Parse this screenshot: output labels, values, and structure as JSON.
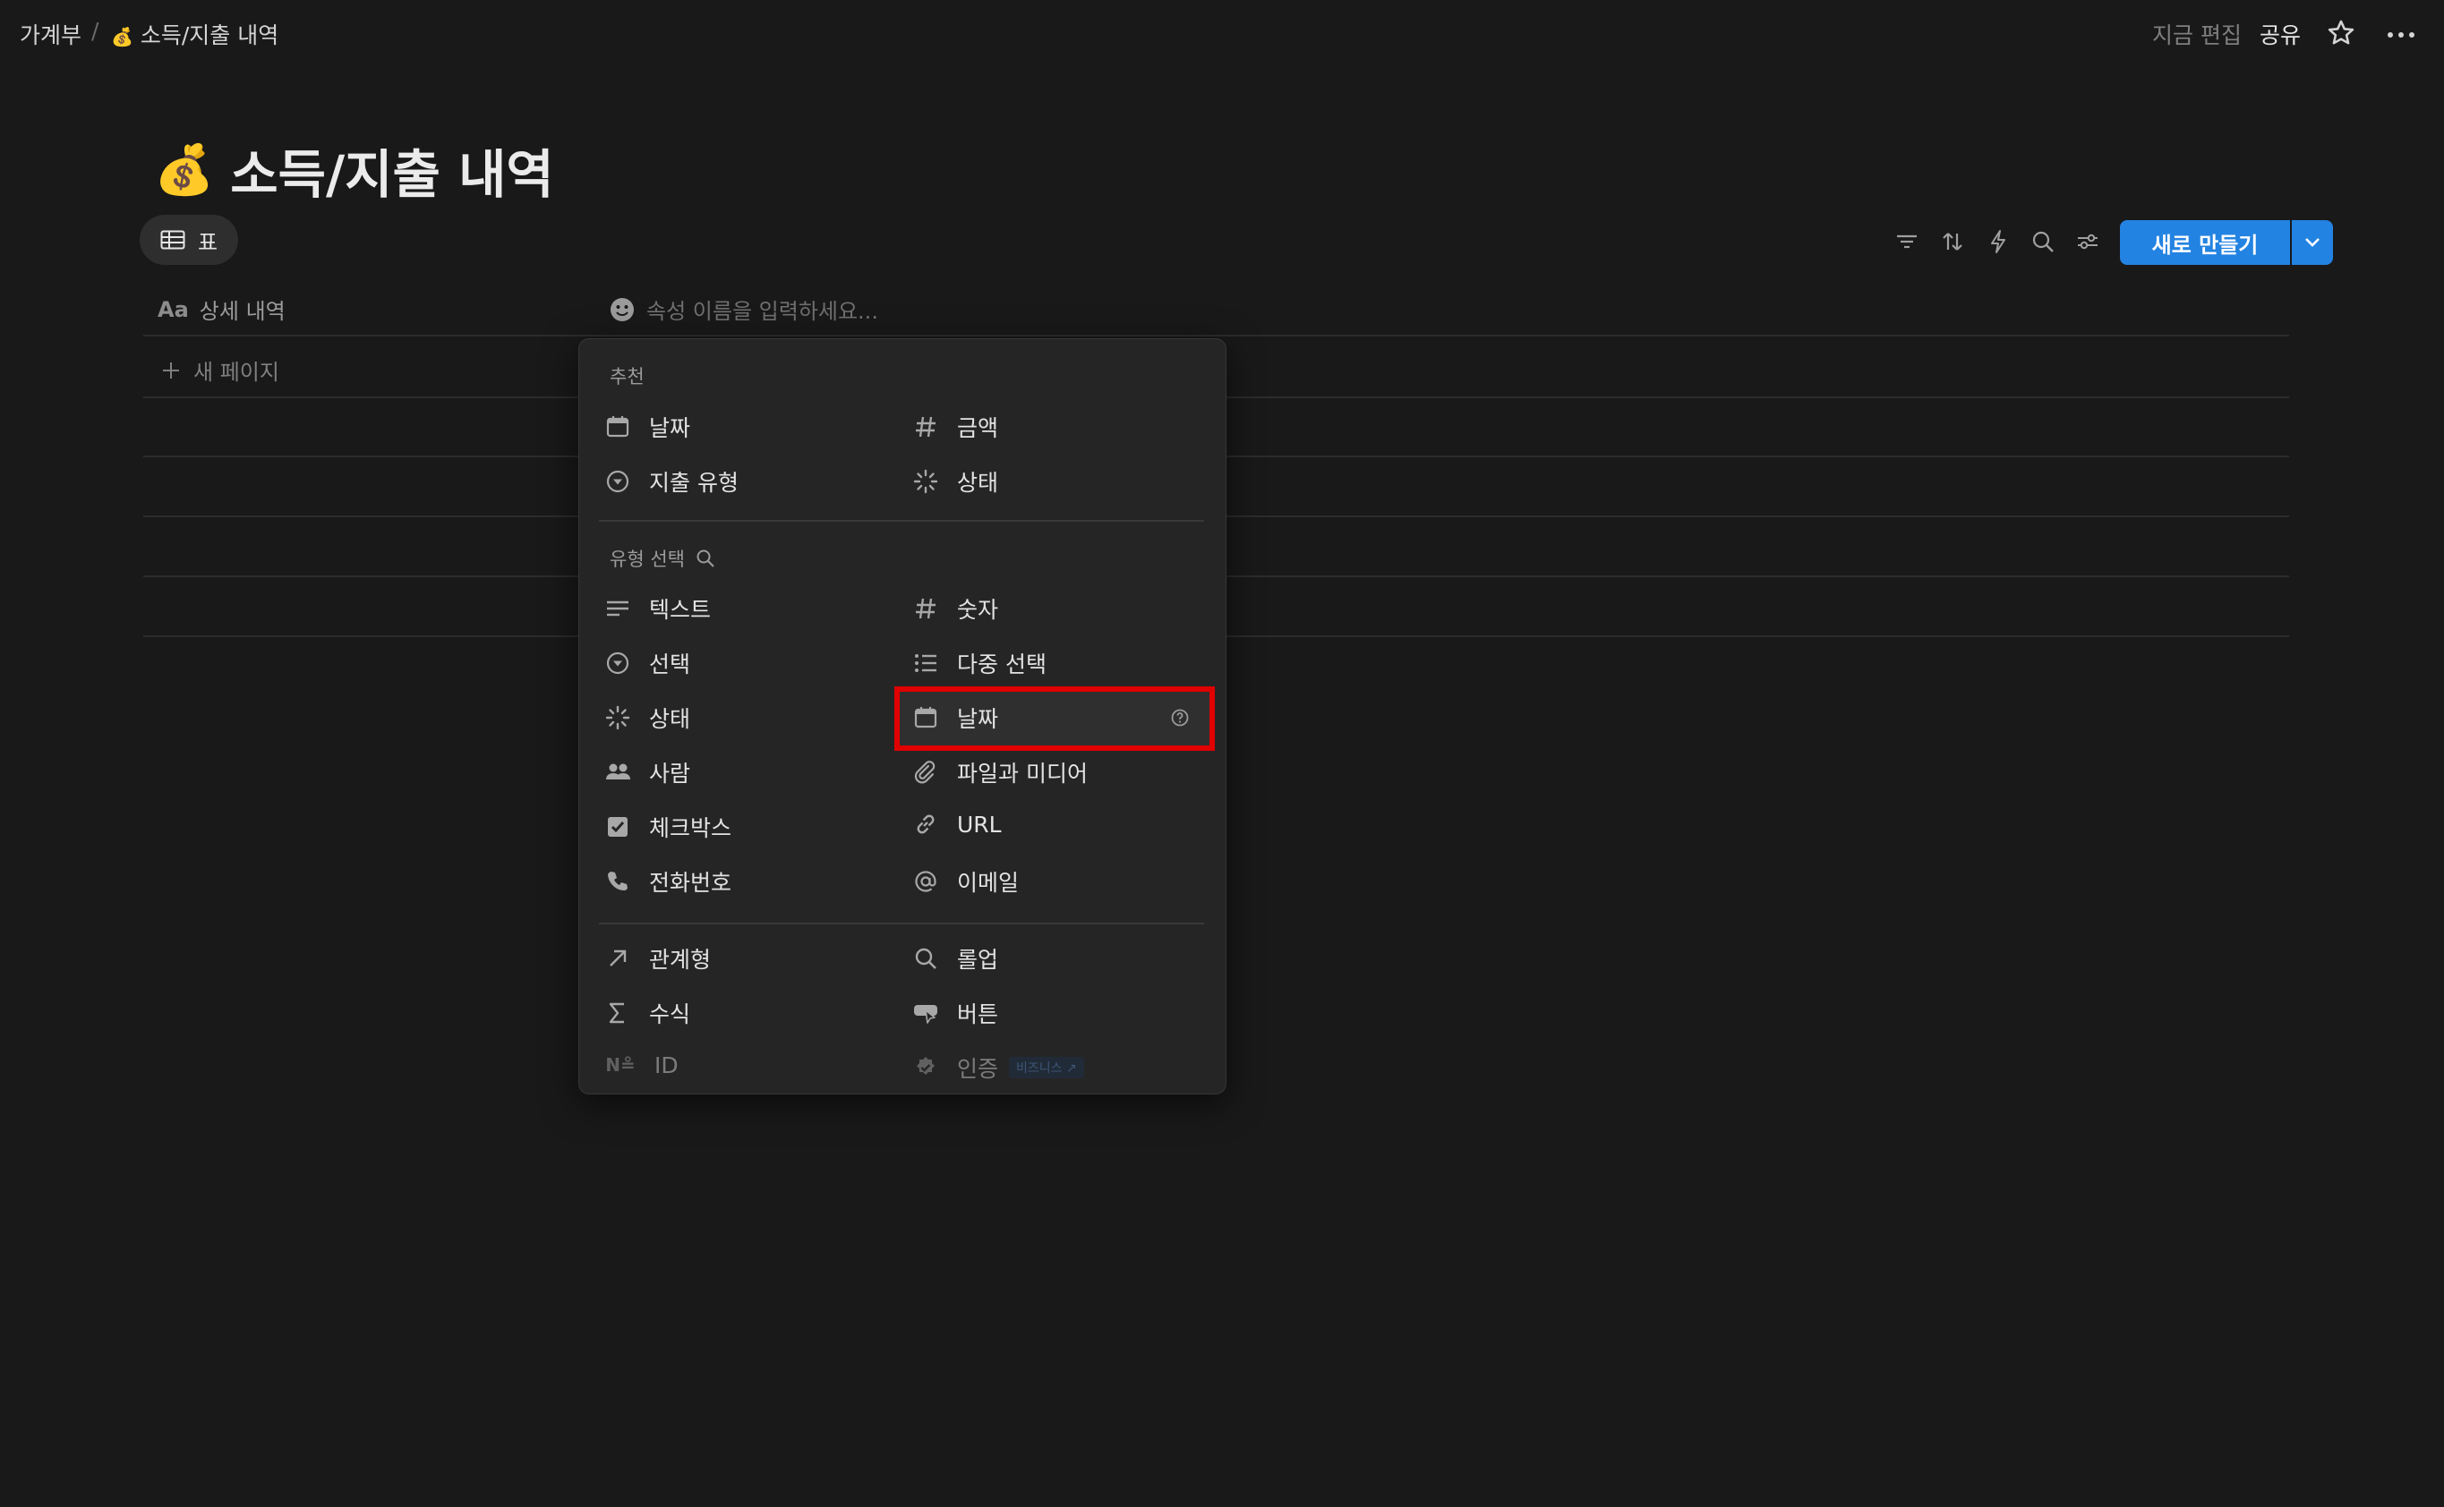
{
  "breadcrumb": {
    "parent": "가계부",
    "separator": "/",
    "current_emoji": "💰",
    "current": "소득/지출 내역"
  },
  "topbar": {
    "edited": "지금 편집",
    "share": "공유"
  },
  "page": {
    "emoji": "💰",
    "title": "소득/지출 내역"
  },
  "view_tab": {
    "label": "표"
  },
  "toolbar": {
    "new_label": "새로 만들기"
  },
  "table": {
    "title_col_icon": "Aa",
    "title_col": "상세 내역",
    "new_prop_placeholder": "속성 이름을 입력하세요...",
    "add_page": "새 페이지"
  },
  "menu": {
    "suggested_label": "추천",
    "suggested": [
      {
        "label": "날짜",
        "icon": "calendar-icon"
      },
      {
        "label": "금액",
        "icon": "hash-icon"
      },
      {
        "label": "지출 유형",
        "icon": "select-icon"
      },
      {
        "label": "상태",
        "icon": "status-icon"
      }
    ],
    "types_label": "유형 선택",
    "types": [
      {
        "label": "텍스트",
        "icon": "text-icon"
      },
      {
        "label": "숫자",
        "icon": "hash-icon"
      },
      {
        "label": "선택",
        "icon": "select-icon"
      },
      {
        "label": "다중 선택",
        "icon": "list-icon"
      },
      {
        "label": "상태",
        "icon": "status-icon"
      },
      {
        "label": "날짜",
        "icon": "calendar-icon"
      },
      {
        "label": "사람",
        "icon": "people-icon"
      },
      {
        "label": "파일과 미디어",
        "icon": "paperclip-icon"
      },
      {
        "label": "체크박스",
        "icon": "checkbox-icon"
      },
      {
        "label": "URL",
        "icon": "link-icon"
      },
      {
        "label": "전화번호",
        "icon": "phone-icon"
      },
      {
        "label": "이메일",
        "icon": "at-icon"
      }
    ],
    "advanced": [
      {
        "label": "관계형",
        "icon": "arrow-up-right-icon"
      },
      {
        "label": "롤업",
        "icon": "magnifier-icon"
      },
      {
        "label": "수식",
        "icon": "sigma-icon"
      },
      {
        "label": "버튼",
        "icon": "button-icon"
      },
      {
        "label": "ID",
        "icon_text": "N≗"
      },
      {
        "label": "인증",
        "icon": "verified-icon",
        "badge": "비즈니스 ↗"
      }
    ]
  },
  "colors": {
    "background": "#191919",
    "panel": "#252525",
    "accent": "#2383e2",
    "highlight_border": "#e00000"
  }
}
